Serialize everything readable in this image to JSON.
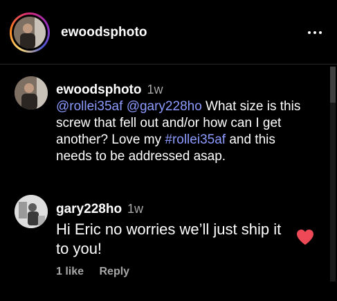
{
  "header": {
    "username": "ewoodsphoto",
    "more_icon": "more-horizontal-icon"
  },
  "comments": [
    {
      "username": "ewoodsphoto",
      "time": "1w",
      "segments": [
        {
          "type": "mention",
          "text": "@rollei35af"
        },
        {
          "type": "text",
          "text": " "
        },
        {
          "type": "mention",
          "text": "@gary228ho"
        },
        {
          "type": "text",
          "text": " What size is this screw that fell out and/or how can I get another? Love my "
        },
        {
          "type": "hashtag",
          "text": "#rollei35af"
        },
        {
          "type": "text",
          "text": " and this needs to be addressed asap."
        }
      ]
    },
    {
      "username": "gary228ho",
      "time": "1w",
      "text": "Hi Eric no worries we’ll just ship it to you!",
      "likes": "1 like",
      "reply_label": "Reply",
      "liked": true
    }
  ],
  "colors": {
    "link": "#8c9bff",
    "muted": "#a8a8a8",
    "heart": "#ed4956"
  }
}
